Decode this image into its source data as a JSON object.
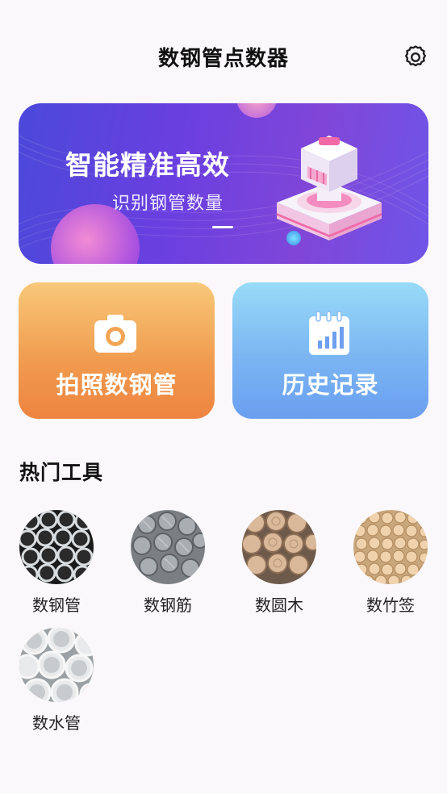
{
  "header": {
    "title": "数钢管点数器",
    "settings_icon": "gear-icon"
  },
  "banner": {
    "title": "智能精准高效",
    "subtitle": "识别钢管数量"
  },
  "actions": [
    {
      "label": "拍照数钢管",
      "icon": "camera-icon",
      "color": "#f19b4f"
    },
    {
      "label": "历史记录",
      "icon": "calendar-chart-icon",
      "color": "#7bb3f2"
    }
  ],
  "tools_section": {
    "title": "热门工具",
    "items": [
      {
        "label": "数钢管",
        "image": "steel-pipes"
      },
      {
        "label": "数钢筋",
        "image": "rebar"
      },
      {
        "label": "数圆木",
        "image": "logs"
      },
      {
        "label": "数竹签",
        "image": "bamboo-sticks"
      },
      {
        "label": "数水管",
        "image": "water-pipes"
      }
    ]
  }
}
